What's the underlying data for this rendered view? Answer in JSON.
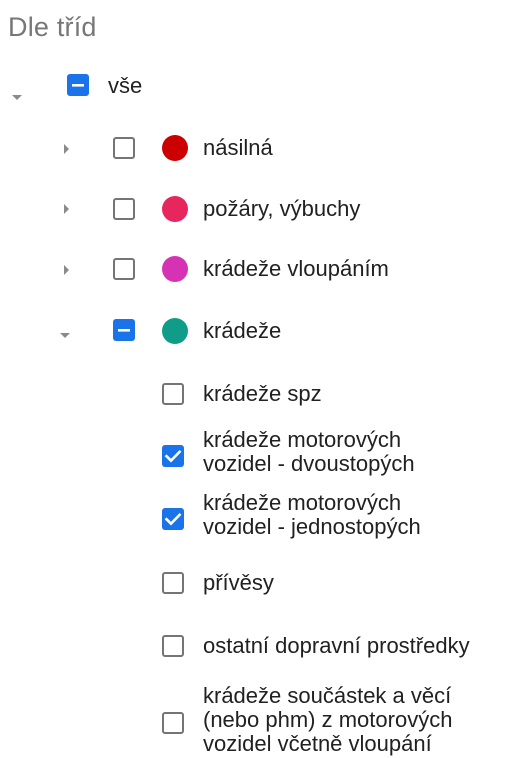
{
  "panel": {
    "title": "Dle tříd"
  },
  "tree": {
    "root": {
      "label": "vše",
      "state": "indeterminate",
      "expanded": true
    },
    "categories": [
      {
        "label": "násilná",
        "color": "#cc0000",
        "state": "unchecked",
        "expanded": false
      },
      {
        "label": "požáry, výbuchy",
        "color": "#e8265e",
        "state": "unchecked",
        "expanded": false
      },
      {
        "label": "krádeže vloupáním",
        "color": "#d633b4",
        "state": "unchecked",
        "expanded": false
      },
      {
        "label": "krádeže",
        "color": "#0f9d8a",
        "state": "indeterminate",
        "expanded": true
      }
    ],
    "subitems": [
      {
        "label": "krádeže spz",
        "state": "unchecked"
      },
      {
        "label": "krádeže motorových\nvozidel - dvoustopých",
        "state": "checked"
      },
      {
        "label": "krádeže motorových\nvozidel - jednostopých",
        "state": "checked"
      },
      {
        "label": "přívěsy",
        "state": "unchecked"
      },
      {
        "label": "ostatní dopravní prostředky",
        "state": "unchecked"
      },
      {
        "label": "krádeže součástek a věcí\n(nebo phm) z motorových\nvozidel včetně vloupání",
        "state": "unchecked"
      }
    ]
  },
  "colors": {
    "checkbox_accent": "#1a73e8",
    "checkbox_border": "#757575",
    "expander": "#8a8a8a"
  },
  "icons": {
    "expanded": "caret-down-icon",
    "collapsed": "caret-right-icon",
    "checked": "check-icon",
    "indeterminate": "minus-icon"
  }
}
